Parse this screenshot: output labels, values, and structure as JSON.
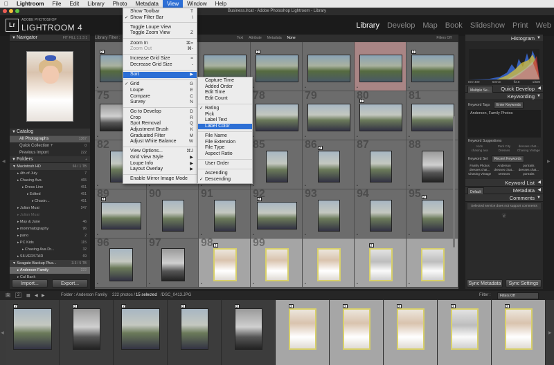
{
  "menubar": {
    "items": [
      "Lightroom",
      "File",
      "Edit",
      "Library",
      "Photo",
      "Metadata",
      "View",
      "Window",
      "Help"
    ],
    "active": "View"
  },
  "window_title": "Business.lrcat - Adobe Photoshop Lightroom - Library",
  "identity": {
    "small": "ADOBE PHOTOSHOP",
    "big": "LIGHTROOM 4",
    "badge": "Lr"
  },
  "modules": [
    "Library",
    "Develop",
    "Map",
    "Book",
    "Slideshow",
    "Print",
    "Web"
  ],
  "active_module": "Library",
  "navigator": {
    "title": "Navigator",
    "zoom_options": "FIT  FILL  1:1  3:1"
  },
  "catalog": {
    "title": "Catalog",
    "items": [
      {
        "label": "All Photographs",
        "count": "1367"
      },
      {
        "label": "Quick Collection +",
        "count": "0"
      },
      {
        "label": "Previous Import",
        "count": "222"
      }
    ]
  },
  "folders": {
    "title": "Folders",
    "drive": {
      "label": "Macintosh HD",
      "count": "66 / 1 TB"
    },
    "items": [
      {
        "label": "4th of July",
        "count": "7",
        "indent": 1
      },
      {
        "label": "Chasing Ava",
        "count": "465",
        "indent": 1
      },
      {
        "label": "Dress Line",
        "count": "451",
        "indent": 2
      },
      {
        "label": "Edited",
        "count": "451",
        "indent": 3
      },
      {
        "label": "Chasin...",
        "count": "451",
        "indent": 4
      },
      {
        "label": "Julian Muai",
        "count": "247",
        "indent": 1
      },
      {
        "label": "Julian Muai",
        "count": "",
        "indent": 1,
        "dim": true
      },
      {
        "label": "May & June",
        "count": "46",
        "indent": 1
      },
      {
        "label": "mommatography",
        "count": "96",
        "indent": 1
      },
      {
        "label": "pano",
        "count": "2",
        "indent": 1
      },
      {
        "label": "PC Kids",
        "count": "115",
        "indent": 1
      },
      {
        "label": "Chasing Ava Dr...",
        "count": "32",
        "indent": 2
      },
      {
        "label": "SILVERSTAR",
        "count": "69",
        "indent": 1
      }
    ],
    "drive2": {
      "label": "Seagate Backup Plus...",
      "count": "3.3 / 5 TB"
    },
    "drive2_items": [
      {
        "label": "Anderson Family",
        "count": "222"
      },
      {
        "label": "Cal Bank",
        "count": ""
      }
    ]
  },
  "left_buttons": {
    "import": "Import...",
    "export": "Export..."
  },
  "library_filter": {
    "label": "Library Filter :",
    "options": [
      "Text",
      "Attribute",
      "Metadata",
      "None"
    ],
    "active": "None",
    "filters_off": "Filters Off"
  },
  "view_menu": {
    "items": [
      {
        "label": "Show Toolbar",
        "shortcut": "T"
      },
      {
        "label": "Show Filter Bar",
        "shortcut": "\\",
        "checked": true
      },
      {
        "sep": true
      },
      {
        "label": "Toggle Loupe View",
        "shortcut": ""
      },
      {
        "label": "Toggle Zoom View",
        "shortcut": "Z"
      },
      {
        "sep": true
      },
      {
        "label": "Zoom In",
        "shortcut": "⌘="
      },
      {
        "label": "Zoom Out",
        "shortcut": "⌘-",
        "disabled": true
      },
      {
        "sep": true
      },
      {
        "label": "Increase Grid Size",
        "shortcut": "="
      },
      {
        "label": "Decrease Grid Size",
        "shortcut": "-"
      },
      {
        "sep": true
      },
      {
        "label": "Sort",
        "submenu": true,
        "highlighted": true
      },
      {
        "sep": true
      },
      {
        "label": "Grid",
        "shortcut": "G",
        "checked": true
      },
      {
        "label": "Loupe",
        "shortcut": "E"
      },
      {
        "label": "Compare",
        "shortcut": "C"
      },
      {
        "label": "Survey",
        "shortcut": "N"
      },
      {
        "sep": true
      },
      {
        "label": "Go to Develop",
        "shortcut": "D"
      },
      {
        "label": "Crop",
        "shortcut": "R"
      },
      {
        "label": "Spot Removal",
        "shortcut": "Q"
      },
      {
        "label": "Adjustment Brush",
        "shortcut": "K"
      },
      {
        "label": "Graduated Filter",
        "shortcut": "M"
      },
      {
        "label": "Adjust White Balance",
        "shortcut": "W"
      },
      {
        "sep": true
      },
      {
        "label": "View Options...",
        "shortcut": "⌘J"
      },
      {
        "label": "Grid View Style",
        "submenu": true
      },
      {
        "label": "Loupe Info",
        "submenu": true
      },
      {
        "label": "Layout Overlay",
        "submenu": true
      },
      {
        "sep": true
      },
      {
        "label": "Enable Mirror Image Mode",
        "shortcut": ""
      }
    ]
  },
  "sort_menu": {
    "items": [
      {
        "label": "Capture Time"
      },
      {
        "label": "Added Order"
      },
      {
        "label": "Edit Time"
      },
      {
        "label": "Edit Count"
      },
      {
        "sep": true
      },
      {
        "label": "Rating",
        "checked": true
      },
      {
        "label": "Pick"
      },
      {
        "label": "Label Text"
      },
      {
        "label": "Label Color",
        "highlighted": true
      },
      {
        "sep": true
      },
      {
        "label": "File Name"
      },
      {
        "label": "File Extension"
      },
      {
        "label": "File Type"
      },
      {
        "label": "Aspect Ratio"
      },
      {
        "sep": true
      },
      {
        "label": "User Order"
      },
      {
        "sep": true
      },
      {
        "label": "Ascending"
      },
      {
        "label": "Descending",
        "checked": true
      }
    ]
  },
  "grid_numbers": [
    "75",
    "76",
    "77",
    "78",
    "79",
    "80",
    "81",
    "82",
    "83",
    "84",
    "85",
    "86",
    "87",
    "88",
    "89",
    "90",
    "91",
    "92",
    "93",
    "94",
    "95",
    "96",
    "97",
    "98",
    "99"
  ],
  "right_panel": {
    "histogram_title": "Histogram",
    "hist_info": [
      "ISO 400",
      "50mm",
      "f/2.8",
      "1/500"
    ],
    "quick_develop": {
      "preset": "Multiple Se...",
      "title": "Quick Develop"
    },
    "keywording": {
      "title": "Keywording",
      "tags_label": "Keyword Tags",
      "tags_value": "Enter Keywords",
      "keywords_text": "Anderson, Family Photos",
      "suggestions_title": "Keyword Suggestions",
      "suggestions": [
        "Kids",
        "Park City",
        "dresses chat...",
        "chasing ava",
        "Dresses",
        "Chasing Vintage"
      ],
      "set_label": "Keyword Set",
      "set_value": "Recent Keywords",
      "set_items": [
        "Family Photos",
        "Anderson",
        "portraits",
        "dresses chat...",
        "dresses chat...",
        "dresses chat...",
        "Chasing Vintage",
        "Dresses",
        "portraits"
      ]
    },
    "keyword_list": "Keyword List",
    "metadata": {
      "preset": "Default",
      "title": "Metadata"
    },
    "comments": {
      "title": "Comments",
      "note": "Selected service does not support comments"
    },
    "buttons": {
      "sync_metadata": "Sync Metadata",
      "sync_settings": "Sync Settings"
    }
  },
  "film_toolbar": {
    "pages": [
      "1",
      "2"
    ],
    "source": "Folder : Anderson Family",
    "count": "222 photos /",
    "selected": "15 selected",
    "file": "/DSC_0413.JPG",
    "filter_label": "Filter :",
    "filter_value": "Filters Off"
  },
  "colors": {
    "accent": "#2c6fd5",
    "selected_border": "#d8d06a",
    "flag_red": "#a98585"
  }
}
